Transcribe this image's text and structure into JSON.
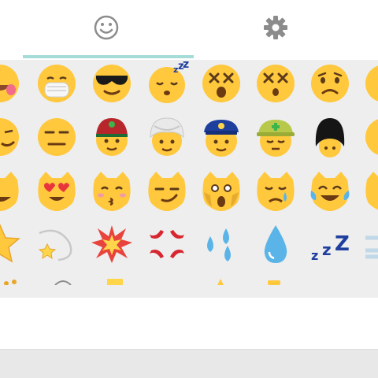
{
  "tabs": [
    {
      "id": "emoji-tab",
      "icon": "smiley-outline-icon",
      "selected": true
    },
    {
      "id": "settings-tab",
      "icon": "gear-icon",
      "selected": false
    }
  ],
  "colors": {
    "tab_indicator": "#a6dcd8",
    "tab_icon": "#8c8c8c",
    "grid_background": "#eeeeee",
    "emoji_yellow": "#ffc83d"
  },
  "emoji_rows": [
    [
      "face-partial-icon",
      "face-with-medical-mask-icon",
      "smiling-face-with-sunglasses-icon",
      "sleeping-face-icon",
      "dizzy-face-icon",
      "dizzy-face-icon",
      "frowning-face-icon",
      "face-partial-icon"
    ],
    [
      "face-partial-icon",
      "neutral-face-icon",
      "boy-with-cap-icon",
      "man-with-turban-icon",
      "police-officer-icon",
      "construction-worker-icon",
      "guard-icon",
      "face-partial-icon"
    ],
    [
      "cat-partial-icon",
      "heart-eyes-cat-icon",
      "kissing-cat-icon",
      "smirk-cat-icon",
      "weary-cat-icon",
      "crying-cat-icon",
      "joy-cat-icon",
      "cat-partial-icon"
    ],
    [
      "star-icon",
      "dizzy-icon",
      "collision-icon",
      "anger-icon",
      "sweat-droplets-icon",
      "droplet-icon",
      "zzz-icon",
      "dash-icon"
    ]
  ]
}
